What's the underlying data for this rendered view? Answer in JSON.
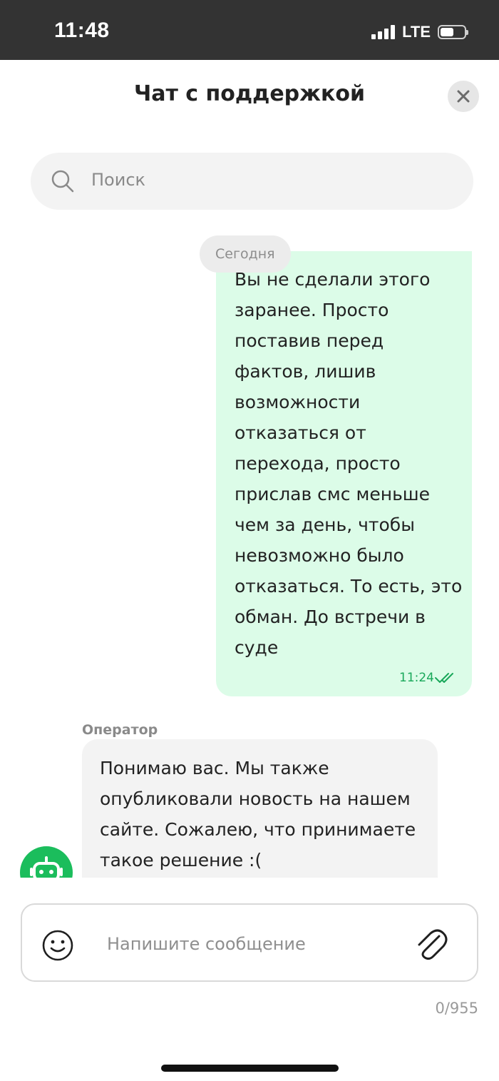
{
  "status_bar": {
    "time": "11:48",
    "network": "LTE",
    "battery_level": 0.55
  },
  "header": {
    "title": "Чат с поддержкой",
    "close_icon": "close-icon"
  },
  "search": {
    "placeholder": "Поиск",
    "icon": "search-icon"
  },
  "chat": {
    "date_separator": "Сегодня",
    "outgoing": {
      "text": "Вы не сделали этого заранее. Просто поставив перед фактов, лишив возможности отказаться от перехода, просто прислав смс меньше чем за день, чтобы невозможно было отказаться. То есть, это обман. До встречи в суде",
      "time": "11:24",
      "status_icon": "double-check-icon"
    },
    "incoming": {
      "sender": "Оператор",
      "text": "Понимаю вас. Мы также опубликовали новость на нашем сайте. Сожалею, что принимаете такое решение :(",
      "avatar_icon": "robot-avatar-icon"
    }
  },
  "composer": {
    "placeholder": "Напишите сообщение",
    "emoji_icon": "emoji-icon",
    "attach_icon": "paperclip-icon",
    "counter": "0/955"
  },
  "colors": {
    "status_bar_bg": "#333333",
    "outgoing_bubble": "#dcfce8",
    "incoming_bubble": "#f3f3f3",
    "accent_green": "#1bbd5c"
  }
}
